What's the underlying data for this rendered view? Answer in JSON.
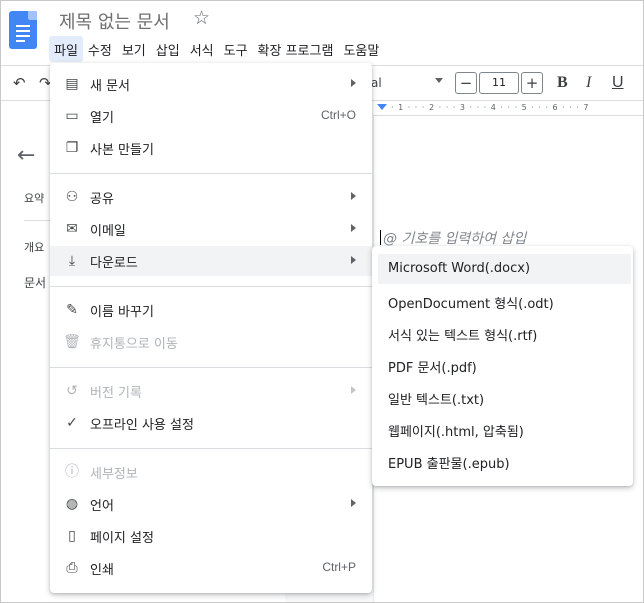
{
  "doc": {
    "title": "제목 없는 문서",
    "star_icon": "star-outline-icon"
  },
  "menubar": [
    "파일",
    "수정",
    "보기",
    "삽입",
    "서식",
    "도구",
    "확장 프로그램",
    "도움말"
  ],
  "toolbar": {
    "font_name": "al",
    "font_size": "11",
    "minus": "−",
    "plus": "+",
    "bold": "B",
    "italic": "I",
    "underline": "U"
  },
  "left_panel": {
    "summary": "요약",
    "outline": "개요",
    "doc_prefix": "문서"
  },
  "ruler": {
    "ticks": "· 1 · · · 2 · · · 3 · · · 4 · · · 5 · · · 6 · · · 7"
  },
  "editor": {
    "hint": "@ 기호를 입력하여 삽입"
  },
  "file_menu": {
    "items": [
      {
        "label": "새 문서",
        "icon": "document-icon",
        "arrow": true
      },
      {
        "label": "열기",
        "icon": "folder-icon",
        "shortcut": "Ctrl+O"
      },
      {
        "label": "사본 만들기",
        "icon": "copy-icon"
      },
      {
        "label": "공유",
        "icon": "person-add-icon",
        "arrow": true
      },
      {
        "label": "이메일",
        "icon": "mail-icon",
        "arrow": true
      },
      {
        "label": "다운로드",
        "icon": "download-icon",
        "arrow": true
      },
      {
        "label": "이름 바꾸기",
        "icon": "pencil-icon"
      },
      {
        "label": "휴지통으로 이동",
        "icon": "trash-icon",
        "disabled": true
      },
      {
        "label": "버전 기록",
        "icon": "history-icon",
        "arrow": true,
        "disabled": true
      },
      {
        "label": "오프라인 사용 설정",
        "icon": "offline-check-icon"
      },
      {
        "label": "세부정보",
        "icon": "info-icon",
        "disabled": true
      },
      {
        "label": "언어",
        "icon": "globe-icon",
        "arrow": true
      },
      {
        "label": "페이지 설정",
        "icon": "page-setup-icon"
      },
      {
        "label": "인쇄",
        "icon": "printer-icon",
        "shortcut": "Ctrl+P"
      }
    ]
  },
  "download_menu": {
    "items": [
      "Microsoft Word(.docx)",
      "OpenDocument 형식(.odt)",
      "서식 있는 텍스트 형식(.rtf)",
      "PDF 문서(.pdf)",
      "일반 텍스트(.txt)",
      "웹페이지(.html, 압축됨)",
      "EPUB 출판물(.epub)"
    ]
  }
}
